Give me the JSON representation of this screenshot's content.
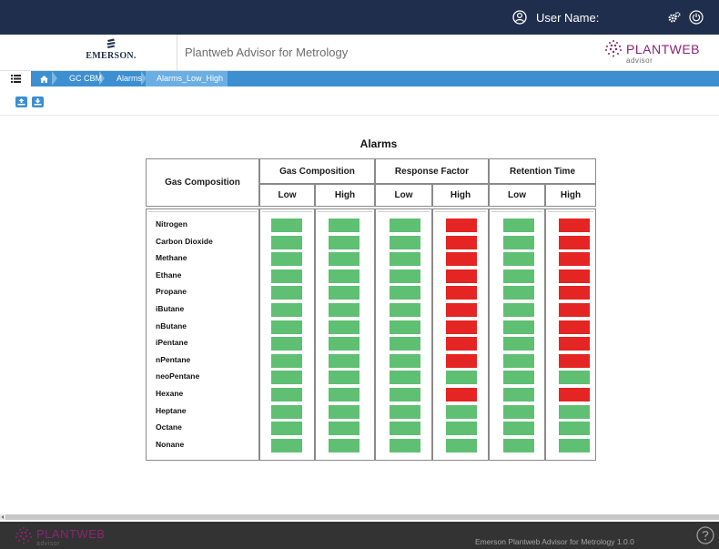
{
  "topbar": {
    "user_name": "User Name:"
  },
  "brand": {
    "company": "EMERSON.",
    "app_title": "Plantweb Advisor for Metrology",
    "logo_text": "PLANTWEB",
    "logo_sub": "advisor"
  },
  "breadcrumb": {
    "items": [
      "GC CBM",
      "Alarms",
      "Alarms_Low_High"
    ]
  },
  "alarms": {
    "title": "Alarms",
    "row_header": "Gas Composition",
    "groups": [
      "Gas Composition",
      "Response Factor",
      "Retention Time"
    ],
    "sub_headers": [
      "Low",
      "High",
      "Low",
      "High",
      "Low",
      "High"
    ],
    "rows": [
      {
        "name": "Nitrogen",
        "states": [
          "ok",
          "ok",
          "ok",
          "alarm",
          "ok",
          "alarm"
        ]
      },
      {
        "name": "Carbon Dioxide",
        "states": [
          "ok",
          "ok",
          "ok",
          "alarm",
          "ok",
          "alarm"
        ]
      },
      {
        "name": "Methane",
        "states": [
          "ok",
          "ok",
          "ok",
          "alarm",
          "ok",
          "alarm"
        ]
      },
      {
        "name": "Ethane",
        "states": [
          "ok",
          "ok",
          "ok",
          "alarm",
          "ok",
          "alarm"
        ]
      },
      {
        "name": "Propane",
        "states": [
          "ok",
          "ok",
          "ok",
          "alarm",
          "ok",
          "alarm"
        ]
      },
      {
        "name": "iButane",
        "states": [
          "ok",
          "ok",
          "ok",
          "alarm",
          "ok",
          "alarm"
        ]
      },
      {
        "name": "nButane",
        "states": [
          "ok",
          "ok",
          "ok",
          "alarm",
          "ok",
          "alarm"
        ]
      },
      {
        "name": "iPentane",
        "states": [
          "ok",
          "ok",
          "ok",
          "alarm",
          "ok",
          "alarm"
        ]
      },
      {
        "name": "nPentane",
        "states": [
          "ok",
          "ok",
          "ok",
          "alarm",
          "ok",
          "alarm"
        ]
      },
      {
        "name": "neoPentane",
        "states": [
          "ok",
          "ok",
          "ok",
          "ok",
          "ok",
          "ok"
        ]
      },
      {
        "name": "Hexane",
        "states": [
          "ok",
          "ok",
          "ok",
          "alarm",
          "ok",
          "alarm"
        ]
      },
      {
        "name": "Heptane",
        "states": [
          "ok",
          "ok",
          "ok",
          "ok",
          "ok",
          "ok"
        ]
      },
      {
        "name": "Octane",
        "states": [
          "ok",
          "ok",
          "ok",
          "ok",
          "ok",
          "ok"
        ]
      },
      {
        "name": "Nonane",
        "states": [
          "ok",
          "ok",
          "ok",
          "ok",
          "ok",
          "ok"
        ]
      }
    ]
  },
  "footer": {
    "logo_text": "PLANTWEB",
    "logo_sub": "advisor",
    "version": "Emerson Plantweb Advisor for Metrology 1.0.0"
  },
  "colors": {
    "topbar": "#1f2e4c",
    "accent_blue": "#3c8fd0",
    "ok_green": "#5fbf73",
    "alarm_red": "#e52424",
    "brand_purple": "#8c2474",
    "footer": "#333333"
  },
  "icons": [
    "user-circle-icon",
    "gears-icon",
    "power-icon",
    "list-menu-icon",
    "home-icon",
    "upload-icon",
    "download-icon",
    "help-icon",
    "scroll-left-icon",
    "plantweb-dots-icon",
    "emerson-logo-icon"
  ]
}
